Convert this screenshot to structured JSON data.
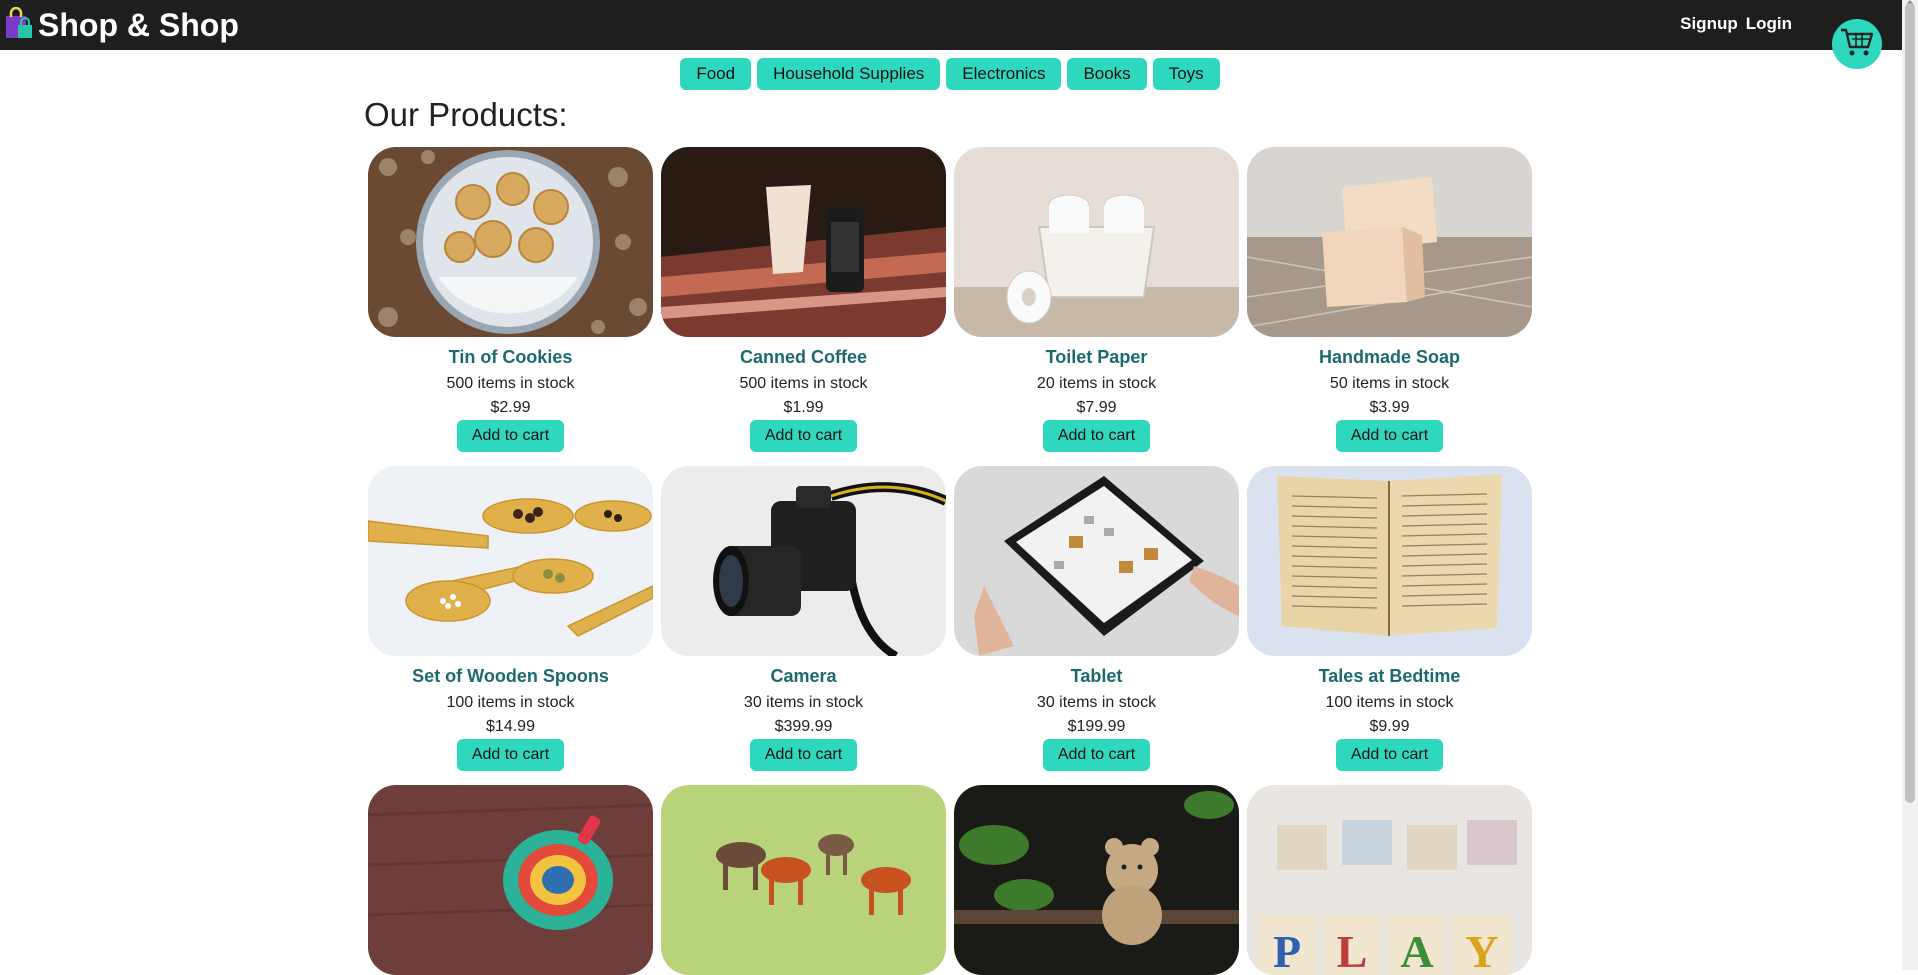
{
  "brand": {
    "name": "Shop & Shop"
  },
  "nav": {
    "signup": "Signup",
    "login": "Login"
  },
  "categories": [
    "Food",
    "Household Supplies",
    "Electronics",
    "Books",
    "Toys"
  ],
  "heading": "Our Products:",
  "add_to_cart_label": "Add to cart",
  "products": [
    {
      "name": "Tin of Cookies",
      "stock": "500 items in stock",
      "price": "$2.99"
    },
    {
      "name": "Canned Coffee",
      "stock": "500 items in stock",
      "price": "$1.99"
    },
    {
      "name": "Toilet Paper",
      "stock": "20 items in stock",
      "price": "$7.99"
    },
    {
      "name": "Handmade Soap",
      "stock": "50 items in stock",
      "price": "$3.99"
    },
    {
      "name": "Set of Wooden Spoons",
      "stock": "100 items in stock",
      "price": "$14.99"
    },
    {
      "name": "Camera",
      "stock": "30 items in stock",
      "price": "$399.99"
    },
    {
      "name": "Tablet",
      "stock": "30 items in stock",
      "price": "$199.99"
    },
    {
      "name": "Tales at Bedtime",
      "stock": "100 items in stock",
      "price": "$9.99"
    }
  ],
  "partial_row_image_text": "PLAY",
  "colors": {
    "accent": "#2ed8bf",
    "topbar": "#1e1e1e",
    "product_title": "#1c6a70"
  },
  "icons": {
    "logo": "shopping-bag-icon",
    "cart": "cart-icon"
  }
}
